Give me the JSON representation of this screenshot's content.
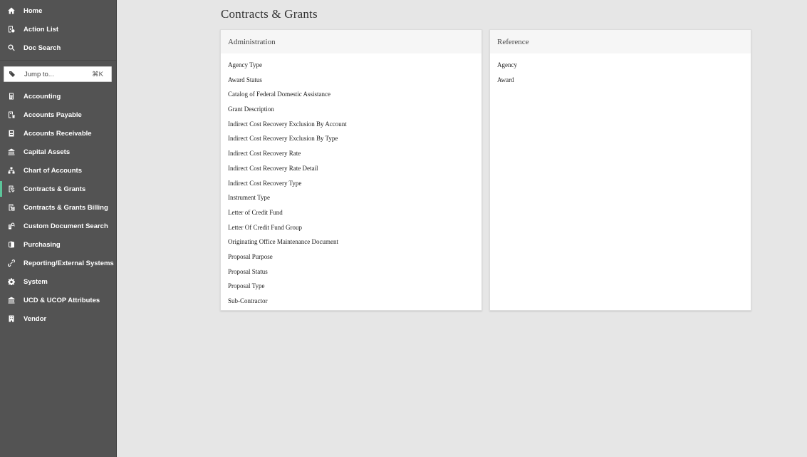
{
  "sidebar": {
    "top": [
      {
        "label": "Home",
        "icon": "home-icon"
      },
      {
        "label": "Action List",
        "icon": "action-list-icon"
      },
      {
        "label": "Doc Search",
        "icon": "search-icon"
      }
    ],
    "jump": {
      "label": "Jump to...",
      "shortcut": "⌘K",
      "icon": "jump-icon"
    },
    "modules": [
      {
        "label": "Accounting",
        "icon": "calculator-icon"
      },
      {
        "label": "Accounts Payable",
        "icon": "accounts-payable-icon"
      },
      {
        "label": "Accounts Receivable",
        "icon": "accounts-receivable-icon"
      },
      {
        "label": "Capital Assets",
        "icon": "bank-icon"
      },
      {
        "label": "Chart of Accounts",
        "icon": "sitemap-icon"
      },
      {
        "label": "Contracts & Grants",
        "icon": "grants-icon",
        "active": true
      },
      {
        "label": "Contracts & Grants Billing",
        "icon": "billing-icon"
      },
      {
        "label": "Custom Document Search",
        "icon": "document-search-icon"
      },
      {
        "label": "Purchasing",
        "icon": "purchasing-icon"
      },
      {
        "label": "Reporting/External Systems",
        "icon": "link-icon"
      },
      {
        "label": "System",
        "icon": "gear-icon"
      },
      {
        "label": "UCD & UCOP Attributes",
        "icon": "institution-icon"
      },
      {
        "label": "Vendor",
        "icon": "building-icon"
      }
    ],
    "active_color": "#5cc59a"
  },
  "main": {
    "title": "Contracts & Grants",
    "panels": {
      "administration": {
        "title": "Administration",
        "links": [
          "Agency Type",
          "Award Status",
          "Catalog of Federal Domestic Assistance",
          "Grant Description",
          "Indirect Cost Recovery Exclusion By Account",
          "Indirect Cost Recovery Exclusion By Type",
          "Indirect Cost Recovery Rate",
          "Indirect Cost Recovery Rate Detail",
          "Indirect Cost Recovery Type",
          "Instrument Type",
          "Letter of Credit Fund",
          "Letter Of Credit Fund Group",
          "Originating Office Maintenance Document",
          "Proposal Purpose",
          "Proposal Status",
          "Proposal Type",
          "Sub-Contractor"
        ]
      },
      "reference": {
        "title": "Reference",
        "links": [
          "Agency",
          "Award"
        ]
      }
    }
  }
}
